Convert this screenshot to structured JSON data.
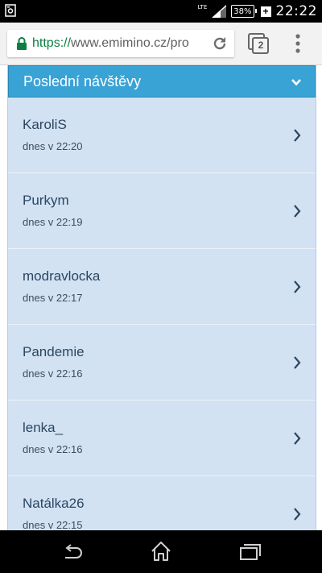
{
  "status_bar": {
    "network": "LTE",
    "battery": "38%",
    "time": "22:22"
  },
  "browser": {
    "url_scheme": "https://",
    "url_rest": "www.emimino.cz/pro",
    "tab_count": "2"
  },
  "section": {
    "title": "Poslední návštěvy"
  },
  "visits": [
    {
      "name": "KaroliS",
      "time": "dnes v 22:20"
    },
    {
      "name": "Purkym",
      "time": "dnes v 22:19"
    },
    {
      "name": "modravlocka",
      "time": "dnes v 22:17"
    },
    {
      "name": "Pandemie",
      "time": "dnes v 22:16"
    },
    {
      "name": "lenka_",
      "time": "dnes v 22:16"
    },
    {
      "name": "Natálka26",
      "time": "dnes v 22:15"
    }
  ],
  "colors": {
    "header_bg": "#3aa3d6",
    "list_bg": "#d2e2f3",
    "name_text": "#2b4661",
    "chevron": "#2b4661"
  }
}
